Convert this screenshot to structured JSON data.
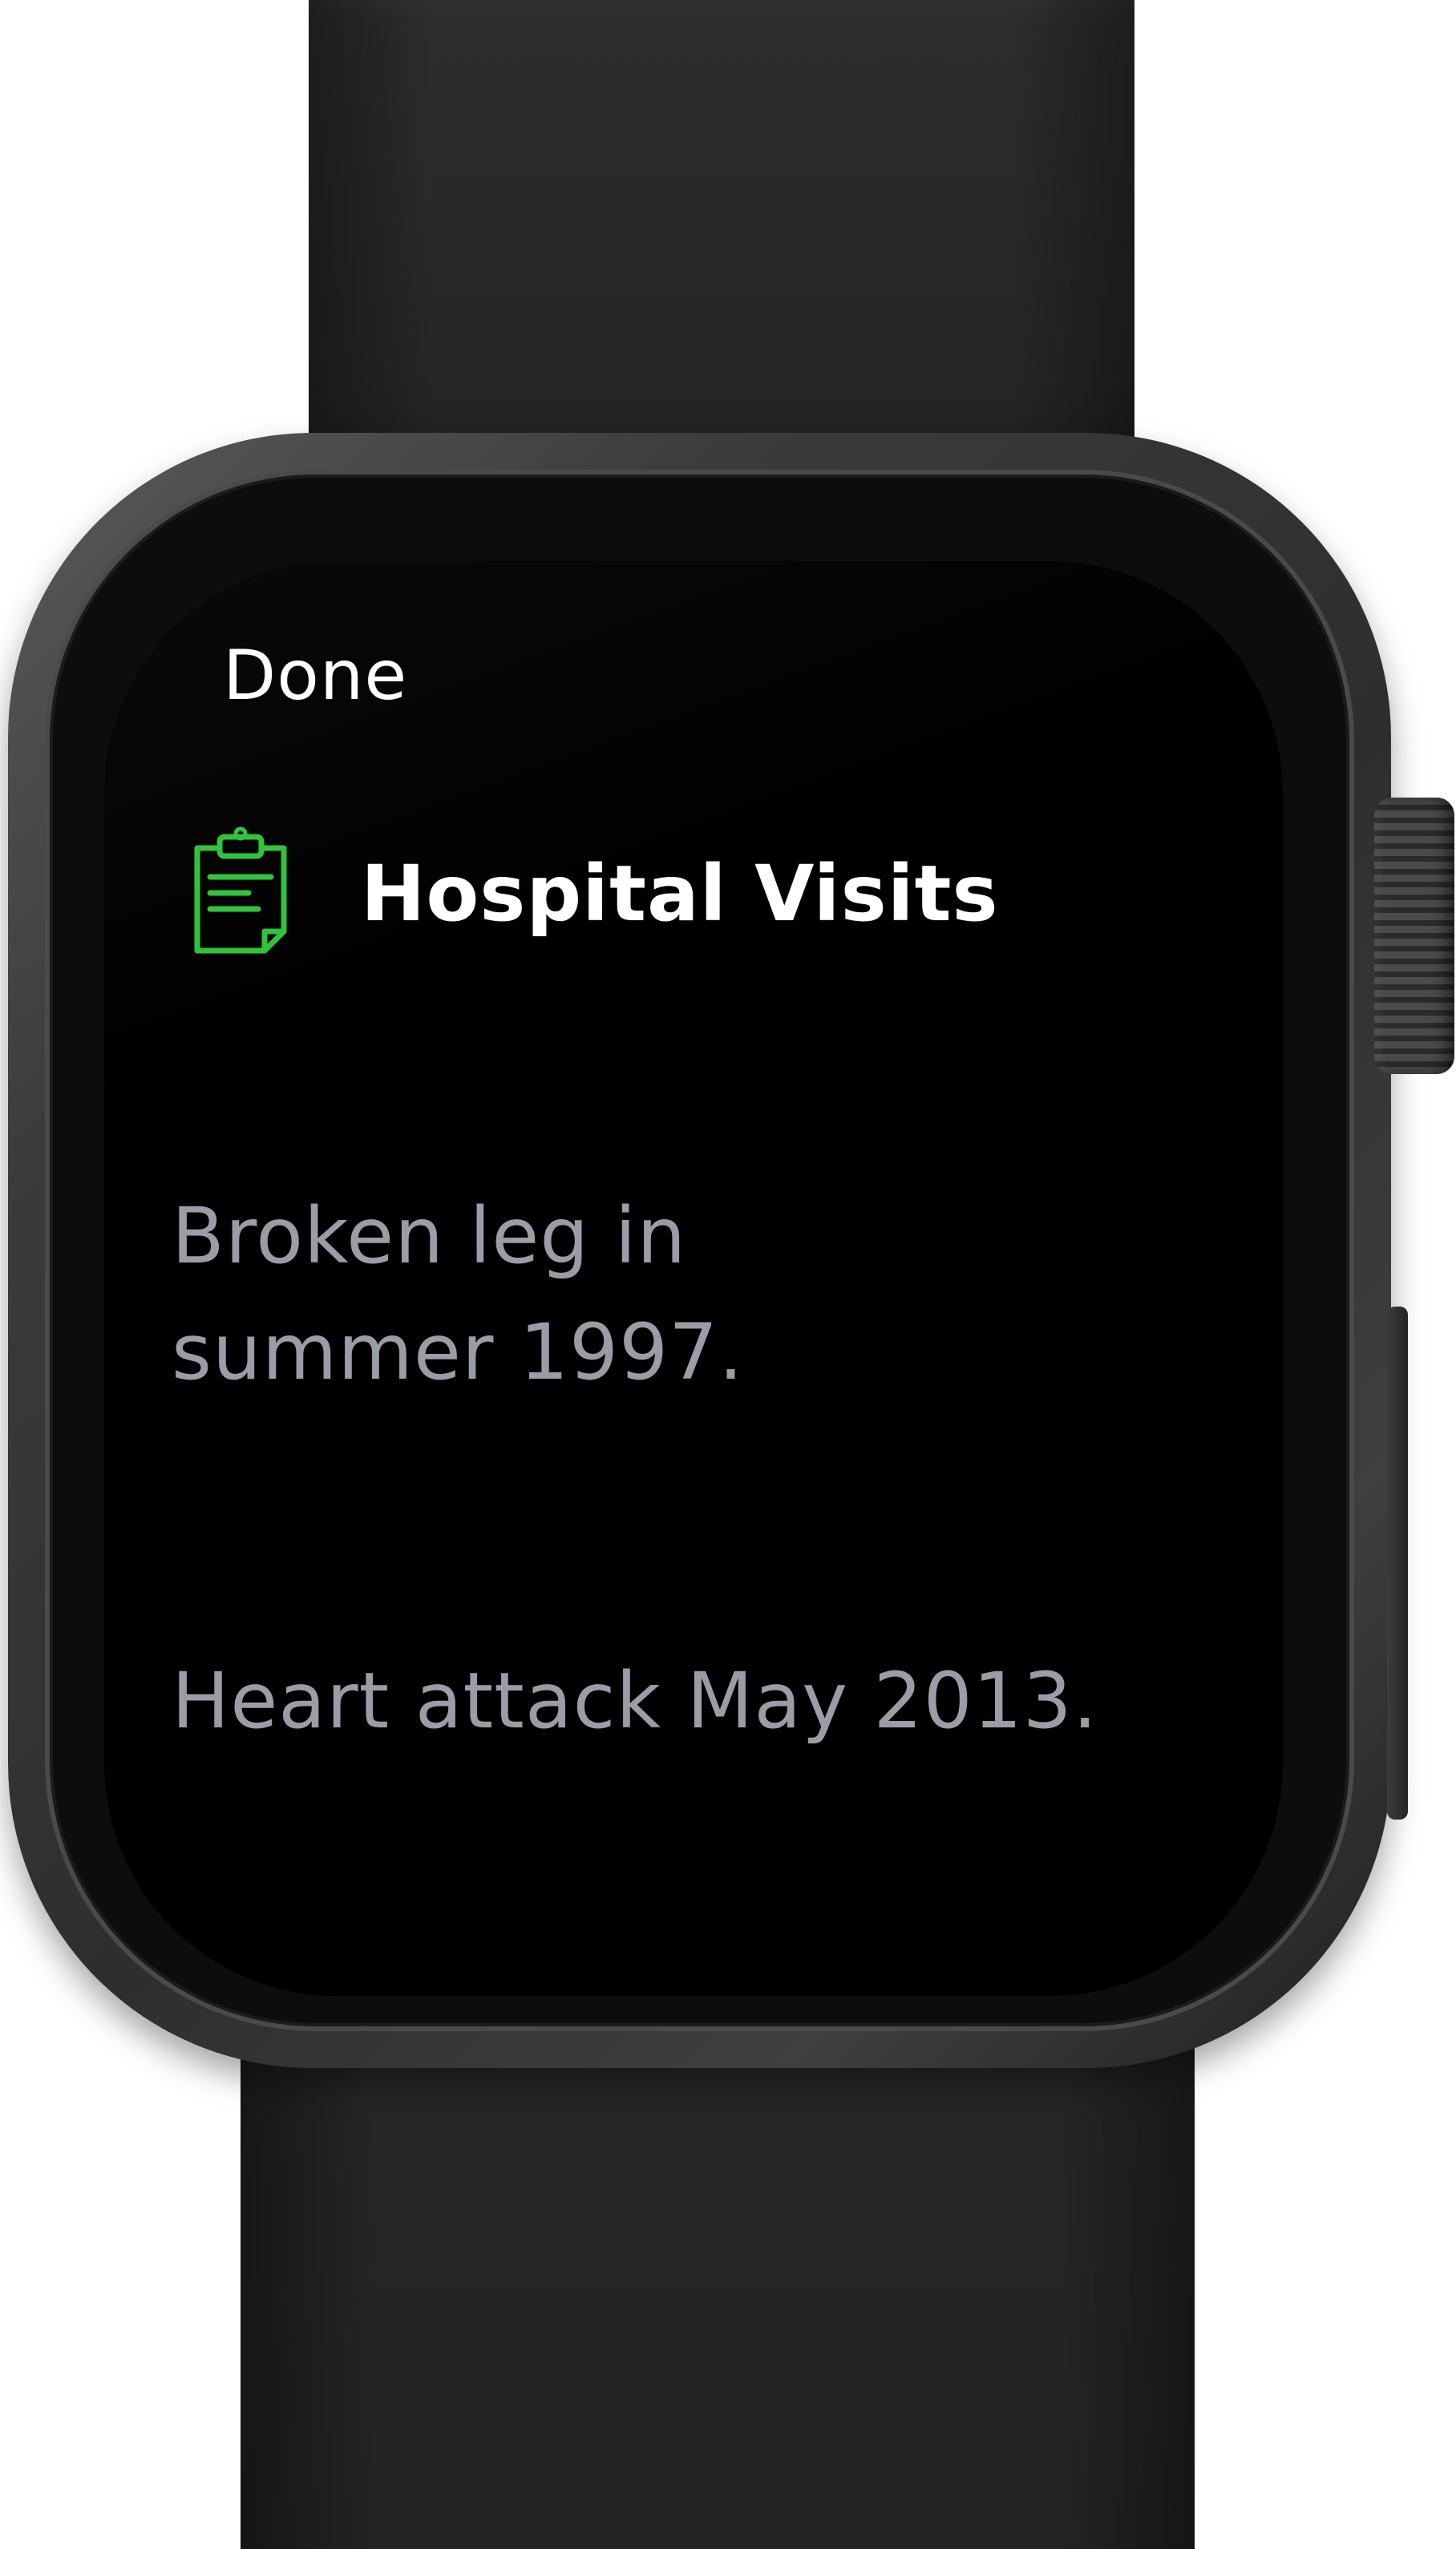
{
  "app": {
    "done_label": "Done",
    "note": {
      "title": "Hospital Visits",
      "icon": "clipboard-icon",
      "paragraphs": [
        "Broken leg in\nsummer 1997.",
        "Heart attack May 2013."
      ]
    }
  },
  "colors": {
    "icon_accent": "#2fc23a",
    "title": "#ffffff",
    "body_text": "#9a9da6",
    "screen_background": "#000000"
  }
}
